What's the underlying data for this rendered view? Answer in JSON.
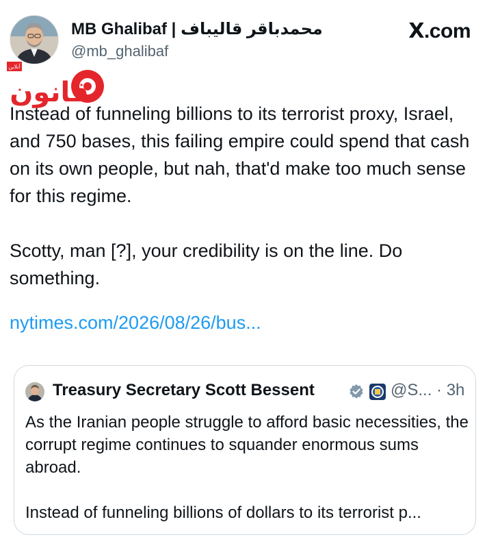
{
  "header": {
    "display_name": "MB Ghalibaf | محمدباقر قالیباف",
    "handle": "@mb_ghalibaf",
    "site_label": ".com",
    "site_logo": "X"
  },
  "watermark": {
    "text": "قانون",
    "small_text": "آنلاین"
  },
  "tweet": {
    "text": "Instead of funneling billions to its terrorist proxy, Israel, and 750 bases, this failing empire could spend that cash on its own people, but nah, that'd make too much sense for this regime.\n\nScotty, man [?], your credibility is on the line. Do something.",
    "link": "nytimes.com/2026/08/26/bus..."
  },
  "quoted_tweet": {
    "name": "Treasury Secretary Scott Bessent",
    "handle_time": "@S... · 3h",
    "text": "As the Iranian people struggle to afford basic necessities, the corrupt regime continues to squander enormous sums abroad.\n\nInstead of funneling billions of dollars to its terrorist p...",
    "verified_color": "#829aab",
    "icons": [
      "verified-badge-icon",
      "treasury-seal-icon"
    ]
  },
  "colors": {
    "link": "#1d9bf0",
    "secondary_text": "#536471",
    "watermark_red": "#e4262c",
    "border": "#cfd9de"
  }
}
